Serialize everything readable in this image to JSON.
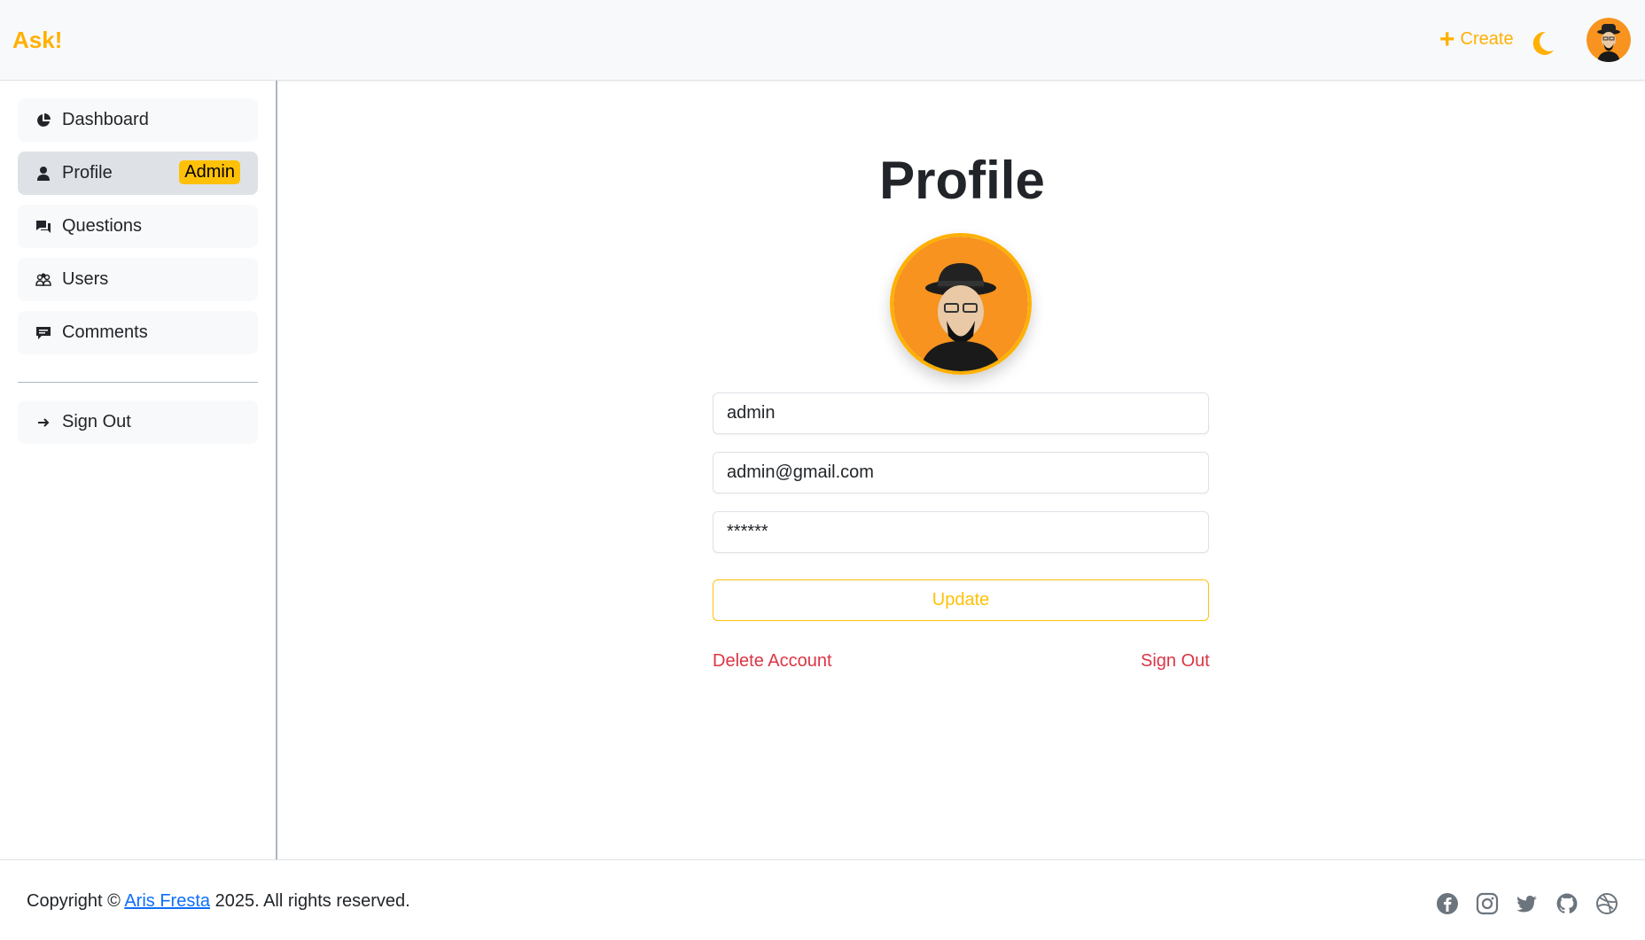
{
  "header": {
    "brand": "Ask!",
    "create_label": "Create",
    "accent_color": "#ffb000"
  },
  "sidebar": {
    "items": [
      {
        "label": "Dashboard",
        "icon": "pie-chart-icon"
      },
      {
        "label": "Profile",
        "icon": "person-icon",
        "badge": "Admin",
        "active": true
      },
      {
        "label": "Questions",
        "icon": "chat-icon"
      },
      {
        "label": "Users",
        "icon": "people-icon"
      },
      {
        "label": "Comments",
        "icon": "comment-icon"
      }
    ],
    "signout": {
      "label": "Sign Out",
      "icon": "arrow-right-icon"
    }
  },
  "main": {
    "title": "Profile",
    "username": "admin",
    "email": "admin@gmail.com",
    "password": "******",
    "update_label": "Update",
    "delete_label": "Delete Account",
    "signout_label": "Sign Out"
  },
  "footer": {
    "copyright_prefix": "Copyright ©",
    "author": "Aris Fresta",
    "copyright_suffix": "2025. All rights reserved.",
    "social": [
      "facebook-icon",
      "instagram-icon",
      "twitter-icon",
      "github-icon",
      "dribbble-icon"
    ]
  }
}
